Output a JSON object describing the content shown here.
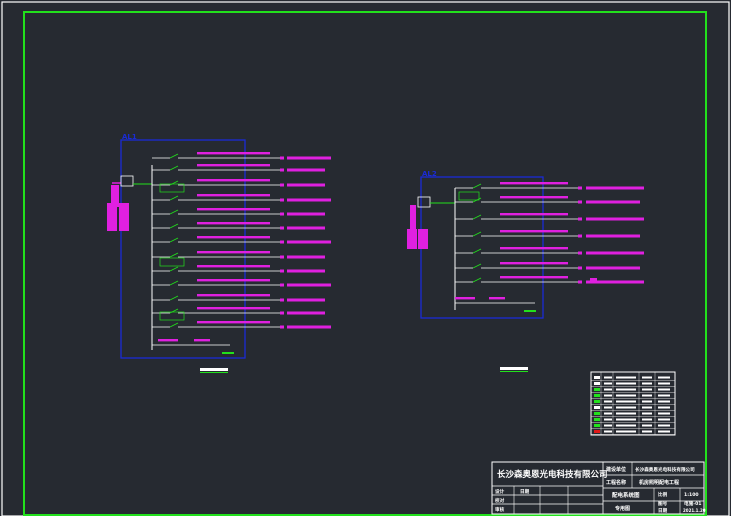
{
  "canvas": {
    "background": "#262a31",
    "frame_color": "#22e01c",
    "border_color": "#ffffff",
    "box_color": "#1a2bd6",
    "circuit_color": "#e020e0",
    "wire_color": "#ffffff",
    "accent_green": "#22e01c",
    "accent_red": "#e01818"
  },
  "panels": [
    {
      "id": "AL1",
      "label": "AL1"
    },
    {
      "id": "AL2",
      "label": "AL2"
    }
  ],
  "legend": {
    "rows": 10,
    "row_marker_colors": [
      "#ffffff",
      "#ffffff",
      "#22e01c",
      "#22e01c",
      "#22e01c",
      "#ffffff",
      "#22e01c",
      "#22e01c",
      "#22e01c",
      "#e01818"
    ]
  },
  "title_block": {
    "company": "长沙森奥恩光电科技有限公司",
    "client_label": "建设单位",
    "client_value": "长沙森奥恩光电科技有限公司",
    "project_label": "工程名称",
    "project_value": "机房照明配电工程",
    "drawing_title": "配电系统图",
    "sheet_note": "专用图",
    "row_labels": [
      "设计",
      "校对",
      "审核"
    ],
    "date_label": "日期",
    "meta_labels": [
      "比例",
      "图号",
      "日期"
    ],
    "meta_values": [
      "1:100",
      "电施-01",
      "2021.1.20"
    ]
  }
}
